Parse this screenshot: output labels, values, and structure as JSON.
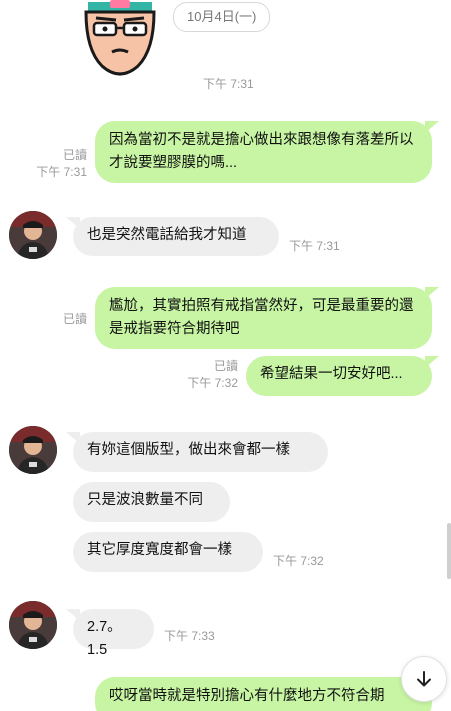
{
  "date_divider": "10月4日(一)",
  "messages": [
    {
      "time": "下午 7:31"
    },
    {
      "read": "已讀",
      "time": "下午 7:31",
      "text": "因為當初不是就是擔心做出來跟想像有落差所以才說要塑膠膜的嗎..."
    },
    {
      "text": "也是突然電話給我才知道",
      "time": "下午 7:31"
    },
    {
      "read": "已讀",
      "text": "尷尬，其實拍照有戒指當然好，可是最重要的還是戒指要符合期待吧"
    },
    {
      "read": "已讀",
      "time": "下午 7:32",
      "text": "希望結果一切安好吧..."
    },
    {
      "text": "有妳這個版型，做出來會都一樣"
    },
    {
      "text": "只是波浪數量不同"
    },
    {
      "text": "其它厚度寬度都會一樣",
      "time": "下午 7:32"
    },
    {
      "text": "2.7。1.5",
      "time": "下午 7:33"
    },
    {
      "text": "哎呀當時就是特別擔心有什麼地方不符合期"
    }
  ],
  "icons": {
    "sticker": "cartoon-face-sticker",
    "avatar": "user-avatar",
    "scroll": "arrow-down-icon"
  },
  "colors": {
    "outgoing_bubble": "#c7f5a3",
    "incoming_bubble": "#eeeeee",
    "meta_text": "#999999"
  }
}
